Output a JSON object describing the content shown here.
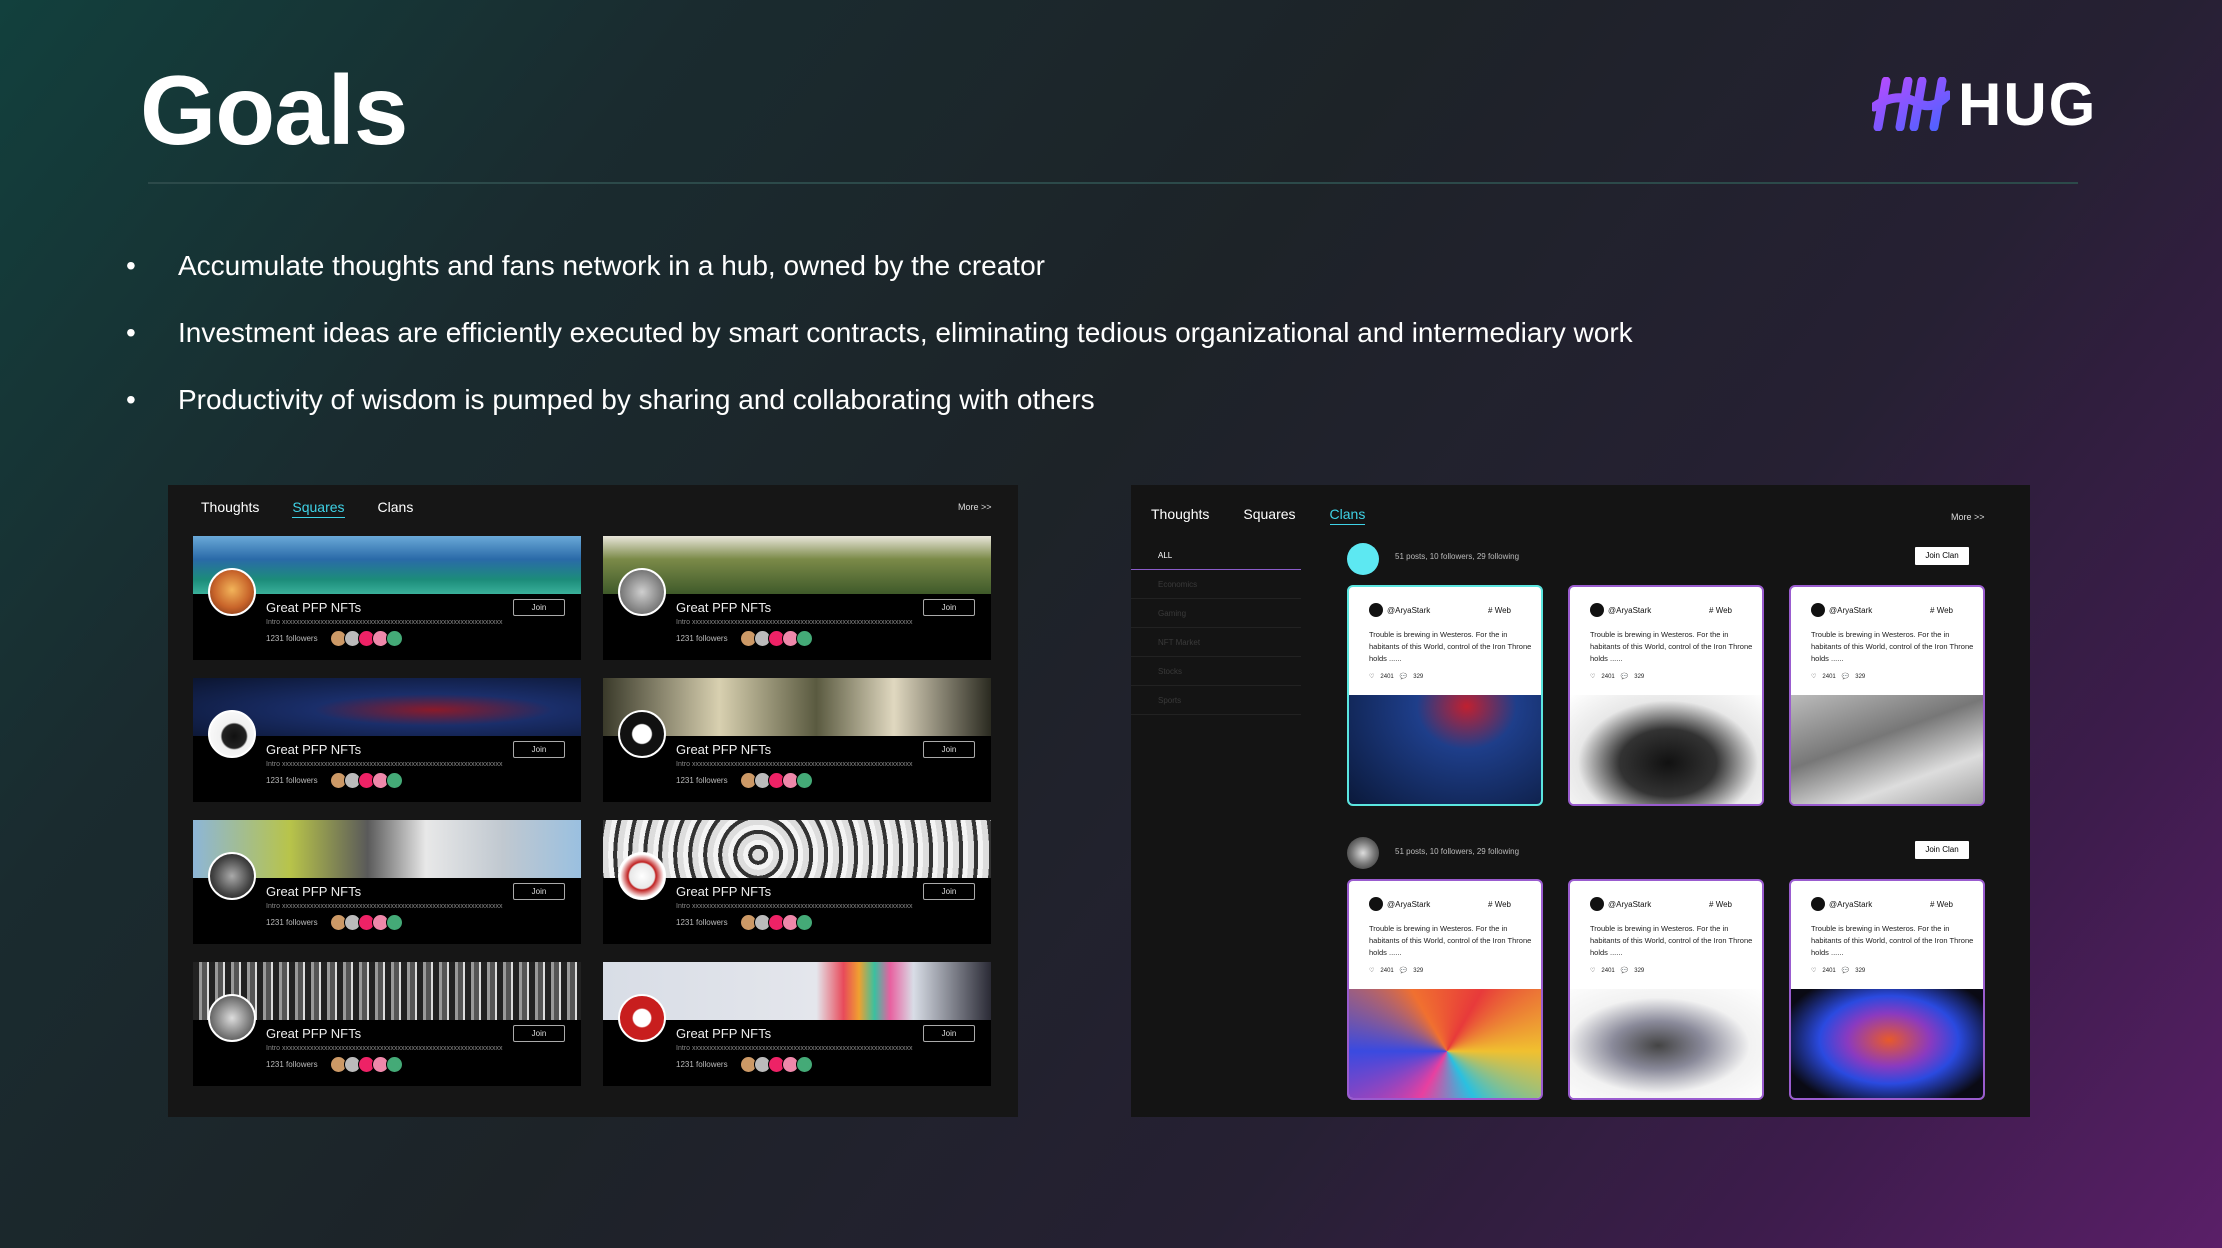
{
  "slide": {
    "title": "Goals",
    "logo_text": "HUG"
  },
  "bullets": [
    "Accumulate thoughts and fans network in a hub, owned by the creator",
    "Investment ideas are efficiently executed by smart contracts, eliminating tedious organizational and intermediary work",
    "Productivity of wisdom is pumped by sharing and collaborating with others"
  ],
  "bullet_symbol": "•",
  "colors": {
    "accent_cyan": "#3fd2e6",
    "accent_purple": "#9a5ccf",
    "card_bg": "#000000"
  },
  "left_shot": {
    "tabs": [
      "Thoughts",
      "Squares",
      "Clans"
    ],
    "active_tab": "Squares",
    "more_label": "More >>",
    "cards": [
      {
        "name": "Great PFP NFTs",
        "intro": "Intro xxxxxxxxxxxxxxxxxxxxxxxxxxxxxxxxxxxxxxxxxxxxxxxxxxxxxxxxxxxxxxx",
        "followers": "1231 followers",
        "join": "Join"
      },
      {
        "name": "Great PFP NFTs",
        "intro": "Intro xxxxxxxxxxxxxxxxxxxxxxxxxxxxxxxxxxxxxxxxxxxxxxxxxxxxxxxxxxxxxxx",
        "followers": "1231 followers",
        "join": "Join"
      },
      {
        "name": "Great PFP NFTs",
        "intro": "Intro xxxxxxxxxxxxxxxxxxxxxxxxxxxxxxxxxxxxxxxxxxxxxxxxxxxxxxxxxxxxxxx",
        "followers": "1231 followers",
        "join": "Join"
      },
      {
        "name": "Great PFP NFTs",
        "intro": "Intro xxxxxxxxxxxxxxxxxxxxxxxxxxxxxxxxxxxxxxxxxxxxxxxxxxxxxxxxxxxxxxx",
        "followers": "1231 followers",
        "join": "Join"
      },
      {
        "name": "Great PFP NFTs",
        "intro": "Intro xxxxxxxxxxxxxxxxxxxxxxxxxxxxxxxxxxxxxxxxxxxxxxxxxxxxxxxxxxxxxxx",
        "followers": "1231 followers",
        "join": "Join"
      },
      {
        "name": "Great PFP NFTs",
        "intro": "Intro xxxxxxxxxxxxxxxxxxxxxxxxxxxxxxxxxxxxxxxxxxxxxxxxxxxxxxxxxxxxxxx",
        "followers": "1231 followers",
        "join": "Join"
      },
      {
        "name": "Great PFP NFTs",
        "intro": "Intro xxxxxxxxxxxxxxxxxxxxxxxxxxxxxxxxxxxxxxxxxxxxxxxxxxxxxxxxxxxxxxx",
        "followers": "1231 followers",
        "join": "Join"
      },
      {
        "name": "Great PFP NFTs",
        "intro": "Intro xxxxxxxxxxxxxxxxxxxxxxxxxxxxxxxxxxxxxxxxxxxxxxxxxxxxxxxxxxxxxxx",
        "followers": "1231 followers",
        "join": "Join"
      }
    ]
  },
  "right_shot": {
    "tabs": [
      "Thoughts",
      "Squares",
      "Clans"
    ],
    "active_tab": "Clans",
    "more_label": "More >>",
    "sidebar": [
      "ALL",
      "Economics",
      "Gaming",
      "NFT Market",
      "Stocks",
      "Sports"
    ],
    "clans": [
      {
        "stats": "51 posts, 10 followers, 29 following",
        "join": "Join Clan",
        "posts": [
          {
            "user": "@AryaStark",
            "tag": "# Web",
            "text": "Trouble is brewing in Westeros. For the in habitants of this World, control of the Iron Throne holds ......",
            "likes": "2401",
            "comments": "329"
          },
          {
            "user": "@AryaStark",
            "tag": "# Web",
            "text": "Trouble is brewing in Westeros. For the in habitants of this World, control of the Iron Throne holds ......",
            "likes": "2401",
            "comments": "329"
          },
          {
            "user": "@AryaStark",
            "tag": "# Web",
            "text": "Trouble is brewing in Westeros. For the in habitants of this World, control of the Iron Throne holds ......",
            "likes": "2401",
            "comments": "329"
          }
        ]
      },
      {
        "stats": "51 posts, 10 followers, 29 following",
        "join": "Join Clan",
        "posts": [
          {
            "user": "@AryaStark",
            "tag": "# Web",
            "text": "Trouble is brewing in Westeros. For the in habitants of this World, control of the Iron Throne holds ......",
            "likes": "2401",
            "comments": "329"
          },
          {
            "user": "@AryaStark",
            "tag": "# Web",
            "text": "Trouble is brewing in Westeros. For the in habitants of this World, control of the Iron Throne holds ......",
            "likes": "2401",
            "comments": "329"
          },
          {
            "user": "@AryaStark",
            "tag": "# Web",
            "text": "Trouble is brewing in Westeros. For the in habitants of this World, control of the Iron Throne holds ......",
            "likes": "2401",
            "comments": "329"
          }
        ]
      }
    ]
  }
}
